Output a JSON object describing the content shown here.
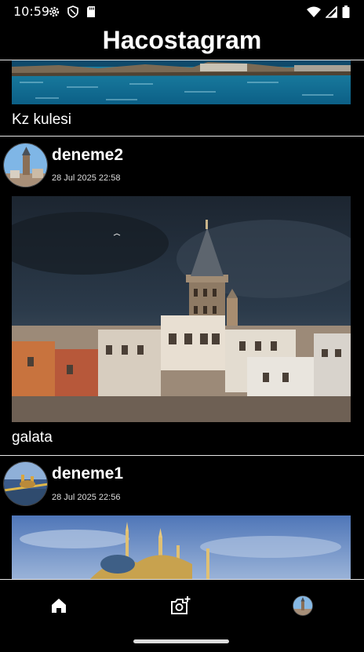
{
  "status_bar": {
    "time": "10:59",
    "left_icons": [
      "gear-icon",
      "shield-icon",
      "sd-card-icon"
    ],
    "right_icons": [
      "wifi-icon",
      "signal-icon",
      "battery-icon"
    ]
  },
  "app": {
    "title": "Hacostagram"
  },
  "feed": {
    "posts": [
      {
        "caption": "Kz kulesi"
      },
      {
        "username": "deneme2",
        "timestamp": "28 Jul 2025 22:58",
        "caption": "galata"
      },
      {
        "username": "deneme1",
        "timestamp": "28 Jul 2025 22:56"
      }
    ]
  },
  "bottom_nav": {
    "items": [
      {
        "icon": "home-icon"
      },
      {
        "icon": "add-photo-icon"
      },
      {
        "icon": "profile-avatar"
      }
    ]
  },
  "colors": {
    "background": "#000000",
    "text": "#ffffff",
    "divider": "#e6e6e6"
  }
}
